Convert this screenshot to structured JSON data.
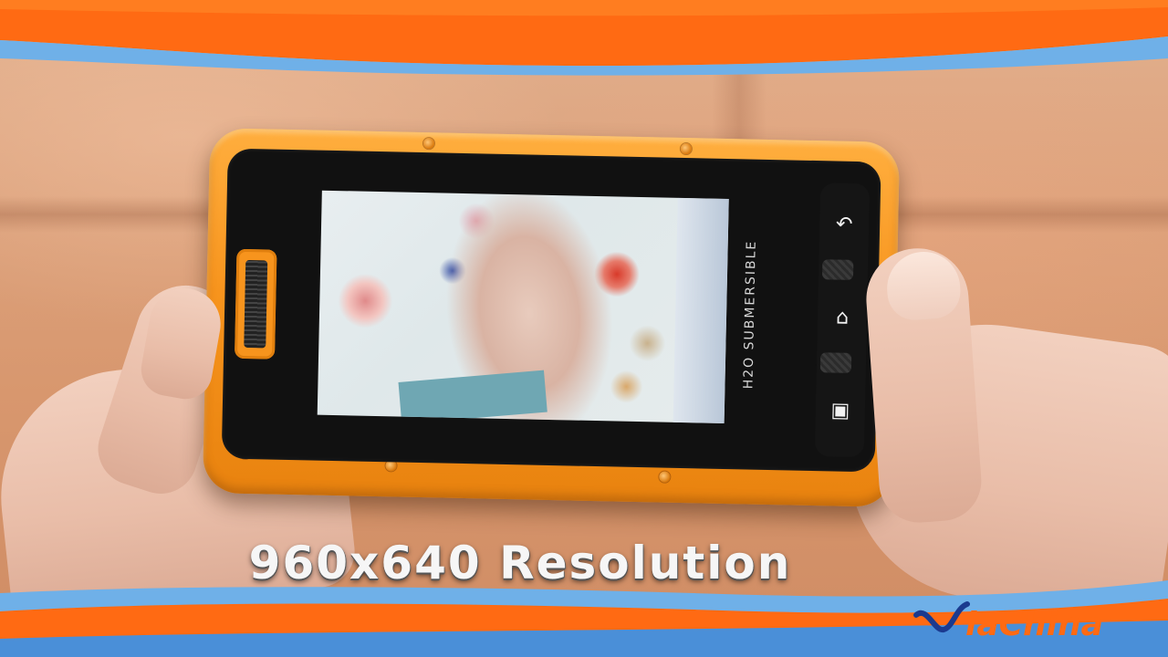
{
  "caption": {
    "text": "960x640 Resolution"
  },
  "phone": {
    "side_label": "H2O SUBMERSIBLE",
    "keys": [
      {
        "name": "back-icon",
        "glyph": "↶"
      },
      {
        "name": "home-icon",
        "glyph": "⌂"
      },
      {
        "name": "menu-icon",
        "glyph": "▣"
      }
    ],
    "body_color": "#f7941d"
  },
  "logo": {
    "brand": "ViaChina",
    "text": "iaChina",
    "color_primary": "#ff6a13",
    "color_secondary": "#1b3a8f"
  },
  "colors": {
    "banner_orange": "#ff6a13",
    "banner_blue": "#4a8fd8"
  }
}
